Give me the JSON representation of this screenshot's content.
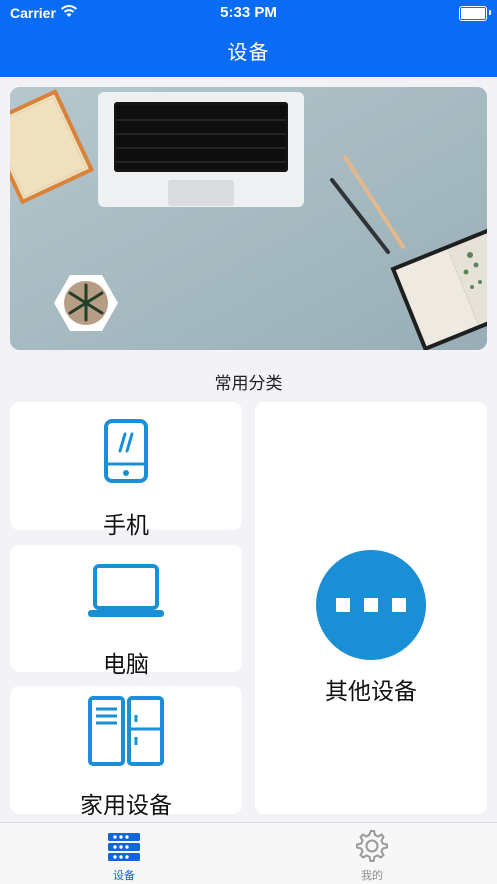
{
  "status_bar": {
    "carrier": "Carrier",
    "time": "5:33 PM"
  },
  "nav": {
    "title": "设备"
  },
  "section": {
    "title": "常用分类"
  },
  "categories": [
    {
      "label": "手机",
      "icon": "phone-icon"
    },
    {
      "label": "电脑",
      "icon": "laptop-icon"
    },
    {
      "label": "家用设备",
      "icon": "cabinet-icon"
    },
    {
      "label": "其他设备",
      "icon": "more-dots-icon"
    }
  ],
  "tabbar": {
    "items": [
      {
        "label": "设备",
        "icon": "devices-icon",
        "selected": true
      },
      {
        "label": "我的",
        "icon": "gear-icon",
        "selected": false
      }
    ]
  },
  "colors": {
    "nav": "#0a6cf5",
    "accent": "#1a8fd6",
    "tab_active": "#1366d6",
    "tab_inactive": "#8e8e93"
  }
}
